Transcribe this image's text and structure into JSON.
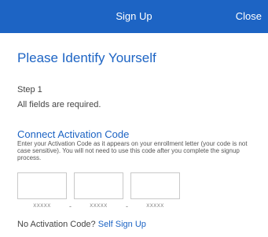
{
  "navbar": {
    "title": "Sign Up",
    "close_label": "Close",
    "color": "#1d64c4"
  },
  "page": {
    "title": "Please Identify Yourself",
    "step": "Step 1",
    "required_note": "All fields are required."
  },
  "activation": {
    "section_title": "Connect Activation Code",
    "instructions": "Enter your Activation Code as it appears on your enrollment letter (your code is not case sensitive). You will not need to use this code after you complete the signup process.",
    "fields": [
      {
        "value": "",
        "hint": "XXXXX"
      },
      {
        "value": "",
        "hint": "XXXXX"
      },
      {
        "value": "",
        "hint": "XXXXX"
      }
    ],
    "separator": "-"
  },
  "footer": {
    "question": "No Activation Code?",
    "link_label": "Self Sign Up"
  }
}
